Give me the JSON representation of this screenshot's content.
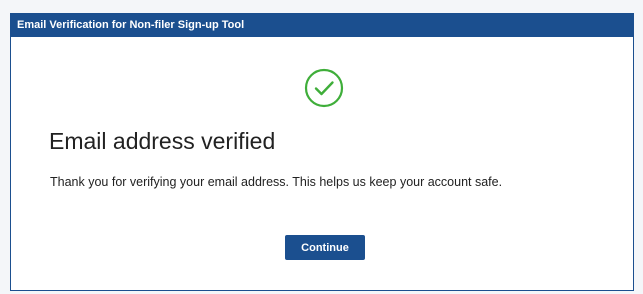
{
  "dialog": {
    "title": "Email Verification for Non-filer Sign-up Tool",
    "heading": "Email address verified",
    "message": "Thank you for verifying your email address. This helps us keep your account safe.",
    "continue_label": "Continue"
  },
  "icons": {
    "status": "check-circle-icon"
  },
  "colors": {
    "header_bg": "#1b4f8f",
    "success_green": "#3fae3a",
    "button_bg": "#1b4f8f"
  }
}
